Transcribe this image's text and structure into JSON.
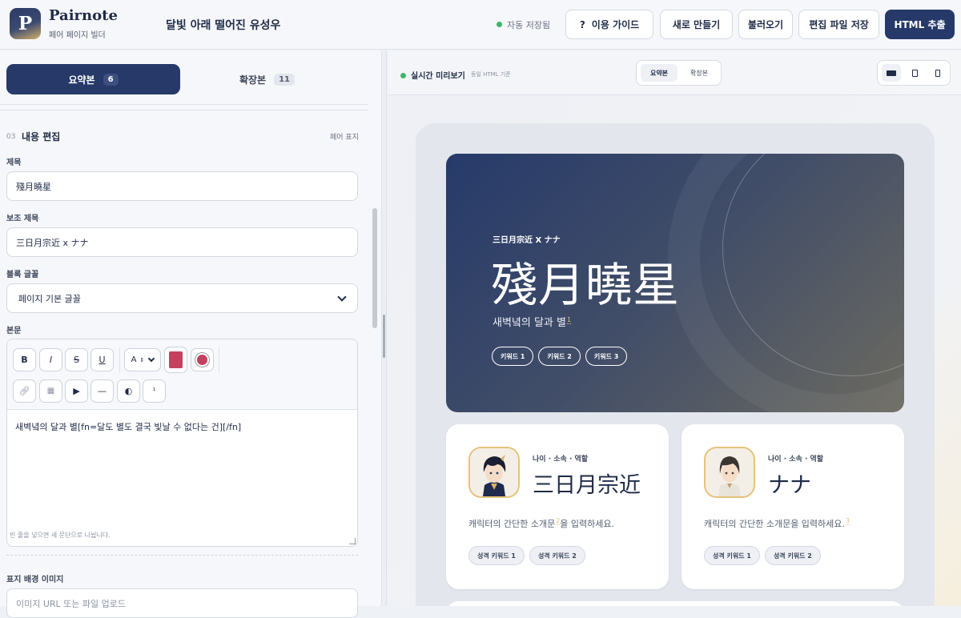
{
  "brand": {
    "logo_letter": "P",
    "name": "Pairnote",
    "subtitle": "페어 페이지 빌더"
  },
  "document_title": "달빛 아래 떨어진 유성우",
  "autosave": "자동 저장됨",
  "toolbar": {
    "guide_icon": "?",
    "guide": "이용 가이드",
    "new": "새로 만들기",
    "load": "불러오기",
    "save": "편집 파일 저장",
    "export": "HTML 추출"
  },
  "left": {
    "tabs": [
      {
        "label": "요약본",
        "count": "6",
        "active": true
      },
      {
        "label": "확장본",
        "count": "11",
        "active": false
      }
    ],
    "section": {
      "number": "03",
      "title": "내용 편집",
      "right_label": "페어 표지"
    },
    "fields": {
      "title_label": "제목",
      "title_value": "殘月曉星",
      "subtitle_label": "보조 제목",
      "subtitle_value": "三日月宗近 x ナナ",
      "font_label": "블록 글꼴",
      "font_value": "페이지 기본 글꼴",
      "body_label": "본문",
      "body_value": "새벽녘의 달과 별[fn=달도 별도 결국 빛날 수 없다는 건][/fn]",
      "body_hint": "빈 줄을 넣으면 새 문단으로 나뉩니다.",
      "bg_label": "표지 배경 이미지",
      "bg_placeholder": "이미지 URL 또는 파일 업로드"
    },
    "editor_toolbar": {
      "bold": "B",
      "italic": "I",
      "strike": "S",
      "underline": "U",
      "size": "A",
      "text_color": "#c4405f",
      "link_icon": "link-icon",
      "image_icon": "image-icon",
      "play_icon": "play-icon",
      "divider_icon": "divider-icon",
      "contrast_icon": "contrast-icon",
      "footnote": "¹"
    }
  },
  "preview": {
    "label": "실시간 미리보기",
    "sublabel": "동일 HTML 기준",
    "tabs": [
      "요약본",
      "확장본"
    ],
    "devices": [
      "desktop-icon",
      "tablet-icon",
      "mobile-icon"
    ],
    "hero": {
      "small": "三日月宗近 X ナナ",
      "title": "殘月曉星",
      "subtitle": "새벽녘의 달과 별",
      "footnote": "1",
      "keywords": [
        "키워드 1",
        "키워드 2",
        "키워드 3"
      ]
    },
    "characters": [
      {
        "meta": "나이 · 소속 · 역할",
        "name": "三日月宗近",
        "desc_a": "캐릭터의 간단한 소개문",
        "fn": "2",
        "desc_b": "을 입력하세요.",
        "keywords": [
          "성격 키워드 1",
          "성격 키워드 2"
        ]
      },
      {
        "meta": "나이 · 소속 · 역할",
        "name": "ナナ",
        "desc_a": "캐릭터의 간단한 소개문을 입력하세요.",
        "fn": "3",
        "desc_b": "",
        "keywords": [
          "성격 키워드 1",
          "성격 키워드 2"
        ]
      }
    ]
  },
  "colors": {
    "primary": "#263969",
    "accent": "#e7c27b",
    "online": "#3fb56c"
  }
}
